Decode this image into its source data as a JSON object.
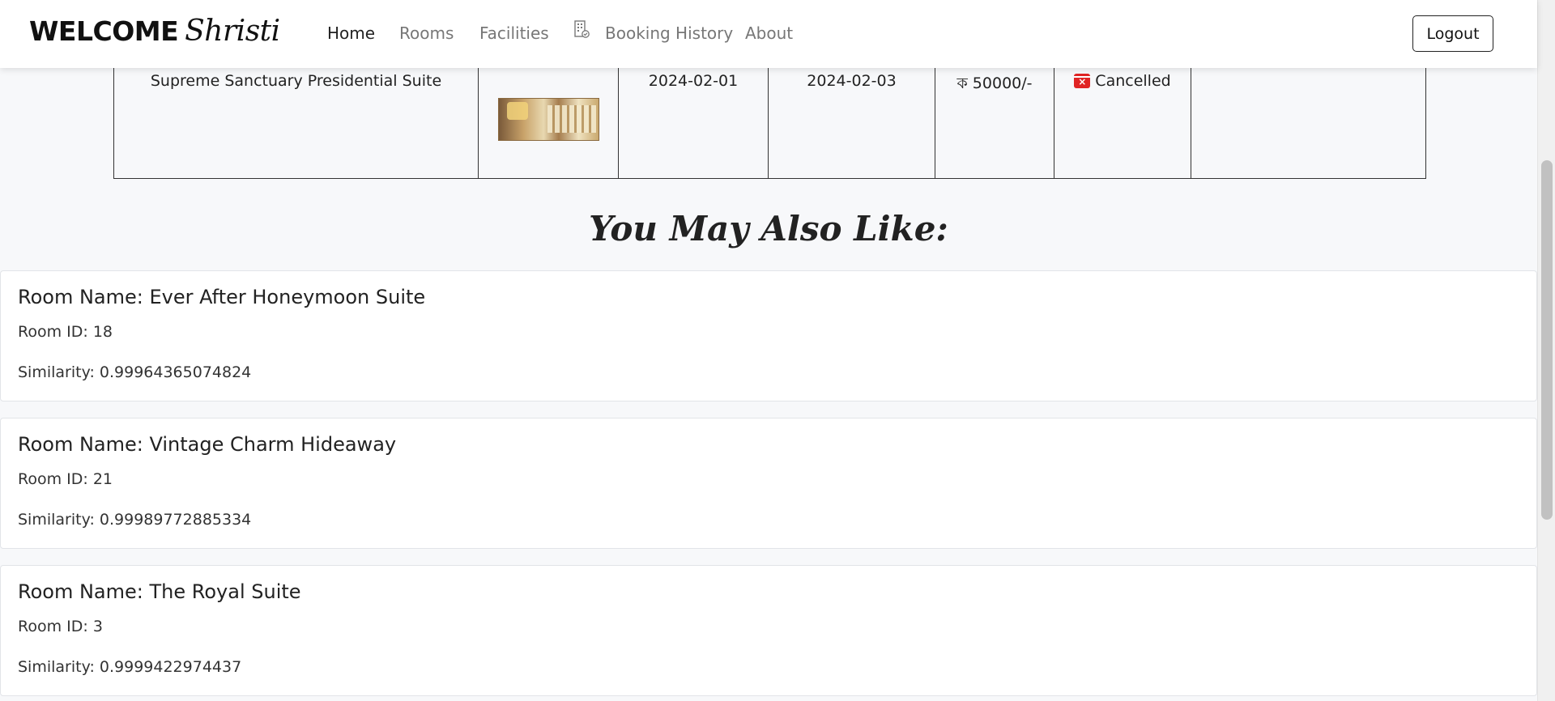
{
  "nav": {
    "brand_prefix": "WELCOME",
    "brand_user": "Shristi",
    "links": [
      "Home",
      "Rooms",
      "Facilities",
      "Booking History",
      "About"
    ],
    "booking_icon": "building-check-icon",
    "logout_label": "Logout"
  },
  "booking_row": {
    "room_name": "Supreme Sanctuary Presidential Suite",
    "image_alt": "room-thumbnail",
    "check_in": "2024-02-01",
    "check_out": "2024-02-03",
    "price": "ক 50000/-",
    "status_icon": "calendar-x-icon",
    "status": "Cancelled",
    "extra": ""
  },
  "recommendations": {
    "heading": "You May Also Like:",
    "items": [
      {
        "title": "Room Name: Ever After Honeymoon Suite",
        "room_id": "Room ID: 18",
        "similarity": "Similarity: 0.99964365074824"
      },
      {
        "title": "Room Name: Vintage Charm Hideaway",
        "room_id": "Room ID: 21",
        "similarity": "Similarity: 0.99989772885334"
      },
      {
        "title": "Room Name: The Royal Suite",
        "room_id": "Room ID: 3",
        "similarity": "Similarity: 0.9999422974437"
      }
    ]
  },
  "colors": {
    "page_bg": "#f7f8fa",
    "card_bg": "#ffffff",
    "cancel_red": "#e02424",
    "nav_inactive": "#777777"
  }
}
